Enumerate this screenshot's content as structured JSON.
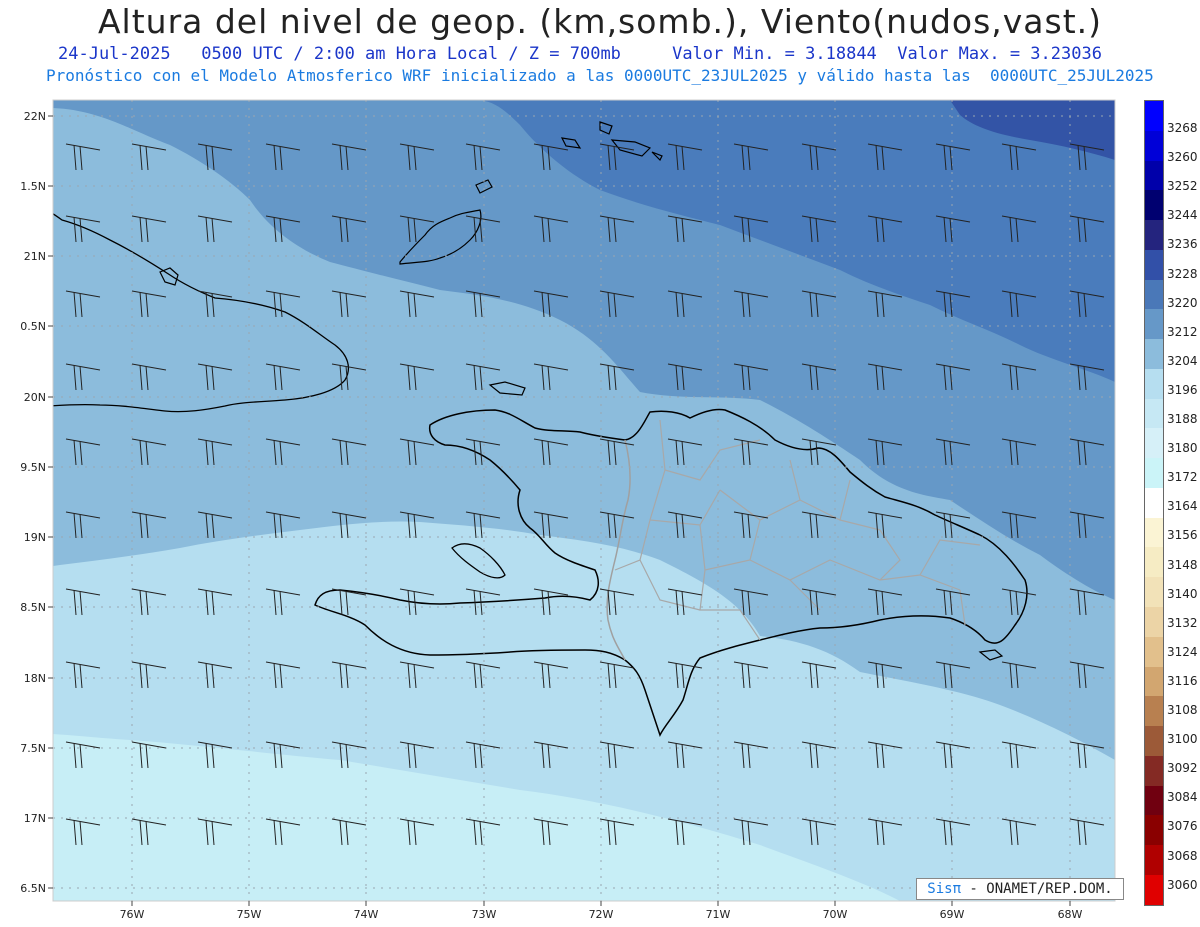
{
  "header": {
    "title": "Altura del nivel de geop. (km,somb.), Viento(nudos,vast.)",
    "line1": "24-Jul-2025   0500 UTC / 2:00 am Hora Local / Z = 700mb     Valor Min. = 3.18844  Valor Max. = 3.23036",
    "line2": "Pronóstico con el Modelo Atmosferico WRF inicializado a las 0000UTC_23JUL2025 y válido hasta las  0000UTC_25JUL2025"
  },
  "axes": {
    "lat_labels": [
      "22N",
      "1.5N",
      "21N",
      "0.5N",
      "20N",
      "9.5N",
      "19N",
      "8.5N",
      "18N",
      "7.5N",
      "17N",
      "6.5N"
    ],
    "lon_labels": [
      "76W",
      "75W",
      "74W",
      "73W",
      "72W",
      "71W",
      "70W",
      "69W",
      "68W"
    ]
  },
  "colorbar": {
    "labels": [
      "3268",
      "3260",
      "3252",
      "3244",
      "3236",
      "3228",
      "3220",
      "3212",
      "3204",
      "3196",
      "3188",
      "3180",
      "3172",
      "3164",
      "3156",
      "3148",
      "3140",
      "3132",
      "3124",
      "3116",
      "3108",
      "3100",
      "3092",
      "3084",
      "3076",
      "3068",
      "3060"
    ],
    "colors": [
      "#0000ff",
      "#0000d8",
      "#0000aa",
      "#000070",
      "#24247e",
      "#3250a8",
      "#4a78b8",
      "#6698c8",
      "#8cbcdc",
      "#b6def0",
      "#c6e8f4",
      "#d6f0f8",
      "#cbf4f8",
      "#ffffff",
      "#fbf4d4",
      "#f6ecc4",
      "#f2e2b8",
      "#ecd4a6",
      "#e2c08c",
      "#d2a670",
      "#b88050",
      "#9c5a38",
      "#842a24",
      "#700010",
      "#8a0000",
      "#b00000",
      "#e00000"
    ]
  },
  "credit": {
    "brand": "Sisπ",
    "text": " - ONAMET/REP.DOM."
  },
  "palette": {
    "lightest": "#c7eef6",
    "light": "#b5def0",
    "medium": "#8cbcdc",
    "medium_dark": "#6598c8",
    "dark": "#4a7cbc",
    "darkest": "#3354a6",
    "coast": "#000000",
    "border": "#a0a0a0"
  }
}
